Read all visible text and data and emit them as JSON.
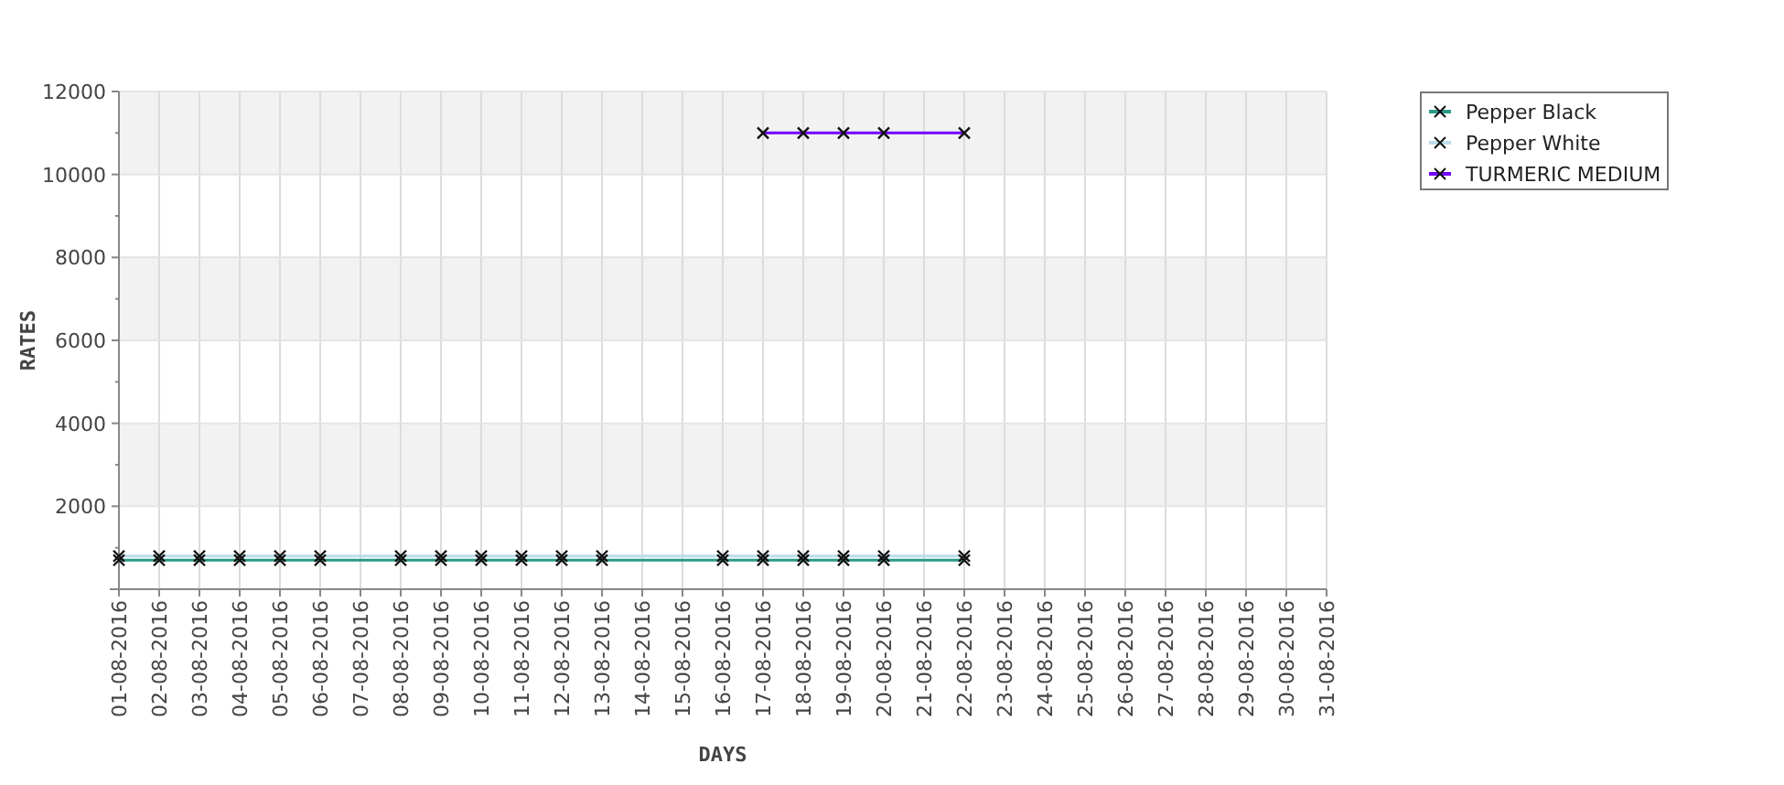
{
  "chart": {
    "chart_data": {
      "type": "line",
      "grid": true,
      "legend": true,
      "xlabel": "DAYS",
      "ylabel": "RATES",
      "categories": [
        "01-08-2016",
        "02-08-2016",
        "03-08-2016",
        "04-08-2016",
        "05-08-2016",
        "06-08-2016",
        "07-08-2016",
        "08-08-2016",
        "09-08-2016",
        "10-08-2016",
        "11-08-2016",
        "12-08-2016",
        "13-08-2016",
        "14-08-2016",
        "15-08-2016",
        "16-08-2016",
        "17-08-2016",
        "18-08-2016",
        "19-08-2016",
        "20-08-2016",
        "21-08-2016",
        "22-08-2016",
        "23-08-2016",
        "24-08-2016",
        "25-08-2016",
        "26-08-2016",
        "27-08-2016",
        "28-08-2016",
        "29-08-2016",
        "30-08-2016",
        "31-08-2016"
      ],
      "series": [
        {
          "name": "Pepper Black",
          "color": "#2a9a86",
          "marker": "x",
          "values": [
            700,
            700,
            700,
            700,
            700,
            700,
            null,
            700,
            700,
            700,
            700,
            700,
            700,
            null,
            null,
            700,
            700,
            700,
            700,
            700,
            null,
            700,
            null,
            null,
            null,
            null,
            null,
            null,
            null,
            null,
            null
          ]
        },
        {
          "name": "Pepper White",
          "color": "#bcdcea",
          "marker": "x",
          "values": [
            800,
            800,
            800,
            800,
            800,
            800,
            null,
            800,
            800,
            800,
            800,
            800,
            800,
            null,
            null,
            800,
            800,
            800,
            800,
            800,
            null,
            800,
            null,
            null,
            null,
            null,
            null,
            null,
            null,
            null,
            null
          ]
        },
        {
          "name": "TURMERIC MEDIUM",
          "color": "#7000ff",
          "marker": "x",
          "values": [
            null,
            null,
            null,
            null,
            null,
            null,
            null,
            null,
            null,
            null,
            null,
            null,
            null,
            null,
            null,
            null,
            11000,
            11000,
            11000,
            11000,
            null,
            11000,
            null,
            null,
            null,
            null,
            null,
            null,
            null,
            null,
            null
          ]
        }
      ],
      "ylim": [
        0,
        12000
      ],
      "yticks": [
        2000,
        4000,
        6000,
        8000,
        10000,
        12000
      ]
    }
  }
}
